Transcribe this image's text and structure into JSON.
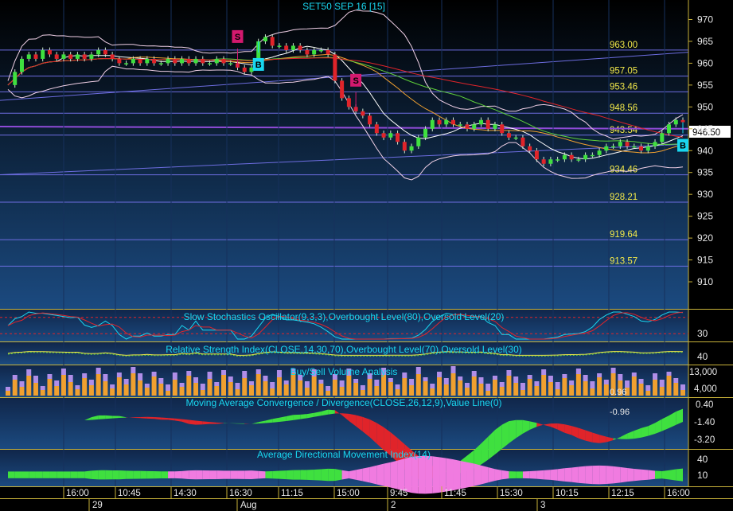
{
  "header": {
    "title": "SET50 SEP 16  [15]"
  },
  "price_axis": {
    "ticks": [
      "970",
      "965",
      "960",
      "955",
      "950",
      "945",
      "940",
      "935",
      "930",
      "925",
      "920",
      "915",
      "910"
    ],
    "last_price": "946.50"
  },
  "levels": [
    "963.00",
    "957.05",
    "953.46",
    "948.56",
    "943.54",
    "934.46",
    "928.21",
    "919.64",
    "913.57"
  ],
  "signals": [
    {
      "label": "S",
      "kind": "sell"
    },
    {
      "label": "S",
      "kind": "sell"
    },
    {
      "label": "B",
      "kind": "buy"
    },
    {
      "label": "B",
      "kind": "buy"
    }
  ],
  "panels": {
    "stoch": {
      "title": "Slow Stochastics Oscillator(9,3,3),Overbought Level(80),Oversold Level(20)",
      "axis": [
        "30"
      ]
    },
    "rsi": {
      "title": "Relative Strength Index(CLOSE,14,30,70),Overbought Level(70),Oversold Level(30)",
      "axis": [
        "40"
      ]
    },
    "volume": {
      "title": "Buy/Sell Volume Analysis",
      "axis": [
        "13,000",
        "4,000"
      ],
      "value_label": "0.96"
    },
    "macd": {
      "title": "Moving Average Convergence / Divergence(CLOSE,26,12,9),Value Line(0)",
      "axis": [
        "0.40",
        "-1.40",
        "-3.20"
      ],
      "value_label": "-0.96"
    },
    "adx": {
      "title": "Average Directional Movement Index(14)",
      "axis": [
        "40",
        "10"
      ]
    }
  },
  "time_axis": {
    "times": [
      "16:00",
      "10:45",
      "14:30",
      "16:30",
      "11:15",
      "15:00",
      "9:45",
      "11:45",
      "15:30",
      "10:15",
      "12:15",
      "16:00"
    ],
    "dates": [
      "29",
      "Aug",
      "2",
      "3"
    ]
  },
  "colors": {
    "background": "#000000",
    "price_panel_top": "#000000",
    "price_panel_bottom": "#1b4a80",
    "level_line": "#6d6de0",
    "level_label": "#f2e84a",
    "sell_badge": "#d3196e",
    "buy_badge": "#19d7f0",
    "up_candle": "#3fe03f",
    "down_candle": "#e0242a"
  },
  "chart_data": {
    "type": "line",
    "title": "SET50 SEP 16  [15]",
    "ylim": [
      906,
      973
    ],
    "close": [
      955,
      958,
      961,
      962,
      961,
      963,
      962,
      961,
      962,
      961,
      962,
      961,
      962,
      963,
      962,
      961,
      960,
      960,
      961,
      960,
      961,
      960,
      960,
      961,
      960,
      961,
      960,
      961,
      960,
      960,
      961,
      960,
      960,
      959,
      958,
      959,
      965,
      966,
      964,
      964,
      963,
      964,
      963,
      962,
      963,
      963,
      962,
      956,
      952,
      950,
      949,
      948,
      946,
      944,
      943,
      944,
      942,
      940,
      941,
      943,
      945,
      947,
      946,
      947,
      946,
      946,
      945,
      946,
      947,
      945,
      946,
      944,
      943,
      943,
      941,
      940,
      938,
      937,
      938,
      938,
      939,
      938,
      938,
      939,
      939,
      940,
      941,
      941,
      942,
      941,
      941,
      940,
      941,
      942,
      944,
      946,
      947,
      946.5
    ],
    "price_levels": [
      963.0,
      957.05,
      953.46,
      948.56,
      943.54,
      934.46,
      928.21,
      919.64,
      913.57
    ],
    "last_price": 946.5,
    "signals": [
      {
        "label": "S",
        "index": 33
      },
      {
        "label": "S",
        "index": 50
      },
      {
        "label": "B",
        "index": 36
      },
      {
        "label": "B",
        "index": 103
      }
    ]
  }
}
